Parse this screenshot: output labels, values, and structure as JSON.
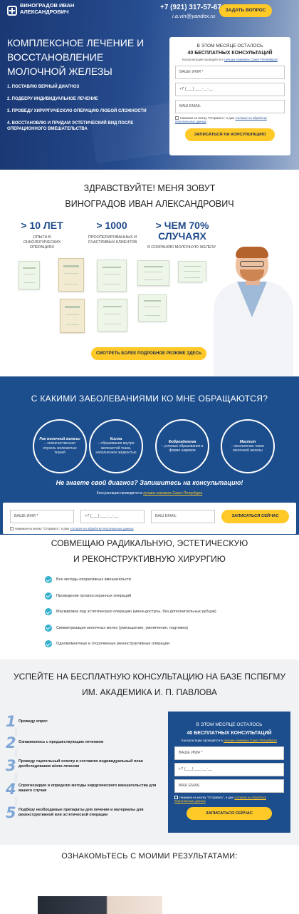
{
  "header": {
    "logo_name": "ВИНОГРАДОВ ИВАН АЛЕКСАНДРОВИЧ",
    "phone": "+7 (921) 317-57-67",
    "email": "i.a.vin@yandex.ru",
    "ask_button": "ЗАДАТЬ ВОПРОС"
  },
  "hero": {
    "title": "КОМПЛЕКСНОЕ ЛЕЧЕНИЕ И ВОССТАНОВЛЕНИЕ МОЛОЧНОЙ ЖЕЛЕЗЫ",
    "items": [
      "1. ПОСТАВЛЮ ВЕРНЫЙ ДИАГНОЗ",
      "2. ПОДБЕРУ ИНДИВИДУАЛЬНОЕ ЛЕЧЕНИЕ",
      "3. ПРОВЕДУ ХИРУРГИЧЕСКУЮ ОПЕРАЦИЮ ЛЮБОЙ СЛОЖНОСТИ",
      "4. ВОССТАНОВЛЮ И ПРИДАМ ЭСТЕТИЧЕСКИЙ ВИД ПОСЛЕ ОПЕРАЦИОННОГО ВМЕШАТЕЛЬСТВА"
    ],
    "form": {
      "top": "В ЭТОМ МЕСЯЦЕ ОСТАЛОСЬ",
      "headline": "40 БЕСПЛАТНЫХ КОНСУЛЬТАЦИЙ",
      "note_prefix": "Консультации проводятся в",
      "note_link": "лучших клиниках Санкт-Петербурга",
      "name_placeholder": "ВАШЕ ИМЯ *",
      "phone_placeholder": "+7 (___) ___-__-__",
      "email_placeholder": "ВАШ EMAIL",
      "consent_prefix": "Нажимая на кнопку \"Отправить\", я даю",
      "consent_link": "согласие на обработку персональных данных",
      "submit": "ЗАПИСАТЬСЯ НА КОНСУЛЬТАЦИЮ"
    }
  },
  "intro": {
    "line1": "ЗДРАВСТВУЙТЕ! МЕНЯ ЗОВУТ",
    "line2": "ВИНОГРАДОВ ИВАН АЛЕКСАНДРОВИЧ",
    "stats": [
      {
        "value": "> 10 ЛЕТ",
        "label": "ОПЫТА В ОНКОЛОГИЧЕСКИХ ОПЕРАЦИЯХ"
      },
      {
        "value": "> 1000",
        "label": "ПРООПЕРИРОВАННЫХ И СЧАСТЛИВЫХ КЛИЕНТОВ"
      },
      {
        "value": "> ЧЕМ 70% СЛУЧАЯХ",
        "label": "Я СОХРАНЯЮ МОЛОЧНУЮ ЖЕЛЕЗУ"
      }
    ],
    "resume_button": "СМОТРЕТЬ БОЛЕЕ ПОДРОБНОЕ РЕЗЮМЕ ЗДЕСЬ"
  },
  "diseases": {
    "title": "С КАКИМИ ЗАБОЛЕВАНИЯМИ КО МНЕ ОБРАЩАЮТСЯ?",
    "items": [
      {
        "name": "Рак молочной железы",
        "desc": "– злокачественная опухоль железистых тканей"
      },
      {
        "name": "Киста",
        "desc": "– образование внутри железистой ткани, наполненное жидкостью"
      },
      {
        "name": "Фиброаденома",
        "desc": "– узловые образования в форме шариков"
      },
      {
        "name": "Мастит",
        "desc": "– воспаление ткани молочной железы"
      }
    ],
    "question": "Не знаете свой диагноз? Запишитесь на консультацию!",
    "note_prefix": "Консультации проводятся в",
    "note_link": "лучших клиниках Санкт-Петербурга",
    "form": {
      "name_placeholder": "ВАШЕ ИМЯ *",
      "phone_placeholder": "+7 (___) ___-__-__",
      "email_placeholder": "ВАШ EMAIL",
      "submit": "ЗАПИСАТЬСЯ СЕЙЧАС",
      "consent_prefix": "Нажимая на кнопку \"Отправить\", я даю",
      "consent_link": "согласие на обработку персональных данных"
    }
  },
  "surgery": {
    "line1": "СОВМЕЩАЮ РАДИКАЛЬНУЮ, ЭСТЕТИЧЕСКУЮ",
    "line2": "И РЕКОНСТРУКТИВНУЮ ХИРУРГИЮ",
    "items": [
      "Все методы оперативных вмешательств",
      "Проведение органосохранных операций",
      "Маскировка под эстетическую операцию (мини-доступы, без дополнительных рубцов)",
      "Симметризация молочных желез (уменьшение, увеличение, подтяжка)",
      "Одномоментные и отсроченные реконструктивные операции"
    ]
  },
  "consult": {
    "line1": "УСПЕЙТЕ НА БЕСПЛАТНУЮ КОНСУЛЬТАЦИЮ НА БАЗЕ ПСПБГМУ",
    "line2": "ИМ. АКАДЕМИКА И. П. ПАВЛОВА",
    "steps": [
      {
        "n": "1",
        "text": "Проведу опрос"
      },
      {
        "n": "2",
        "text": "Ознакомлюсь с предшествующим лечением"
      },
      {
        "n": "3",
        "text": "Проведу тщательный осмотр и составлю индивидуальный план дообследования и/или лечения"
      },
      {
        "n": "4",
        "text": "Спрогнозирую и определю методы хирургического вмешательства для вашего случая"
      },
      {
        "n": "5",
        "text": "Подберу необходимые препараты для лечения и материалы для реконструктивной или эстетической операции"
      }
    ],
    "form": {
      "top": "В ЭТОМ МЕСЯЦЕ ОСТАЛОСЬ",
      "headline": "40 БЕСПЛАТНЫХ КОНСУЛЬТАЦИЙ",
      "note_prefix": "Консультации проводятся в",
      "note_link": "лучших клиниках Санкт-Петербурга",
      "name_placeholder": "ВАШЕ ИМЯ *",
      "phone_placeholder": "+7 (___) ___-__-__",
      "email_placeholder": "ВАШ EMAIL",
      "consent_prefix": "Нажимая на кнопку \"Отправить\", я даю",
      "consent_link": "согласие на обработку персональных данных",
      "submit": "ЗАПИСАТЬСЯ СЕЙЧАС"
    }
  },
  "results": {
    "title": "ОЗНАКОМЬТЕСЬ С МОИМИ РЕЗУЛЬТАТАМИ:"
  },
  "colors": {
    "brand_blue": "#1c4d8c",
    "accent_yellow": "#ffc928",
    "check_teal": "#35b0cc"
  }
}
